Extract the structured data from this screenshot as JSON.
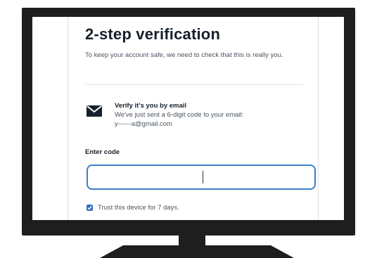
{
  "verification": {
    "title": "2-step verification",
    "subtitle": "To keep your account safe, we need to check that this is really you.",
    "email": {
      "icon": "envelope-icon",
      "heading": "Verify it's you by email",
      "line1": "We've just sent a 6-digit code to your email:",
      "line2": "y------a@gmail.com"
    },
    "code_label": "Enter code",
    "code_value": "",
    "trust_device": {
      "checked": true,
      "label": "Trust this device for 7 days."
    }
  },
  "colors": {
    "bezel": "#1e1e1e",
    "input_border": "#3d7ec9",
    "checkbox": "#2f6fbf",
    "title_text": "#15202b"
  }
}
